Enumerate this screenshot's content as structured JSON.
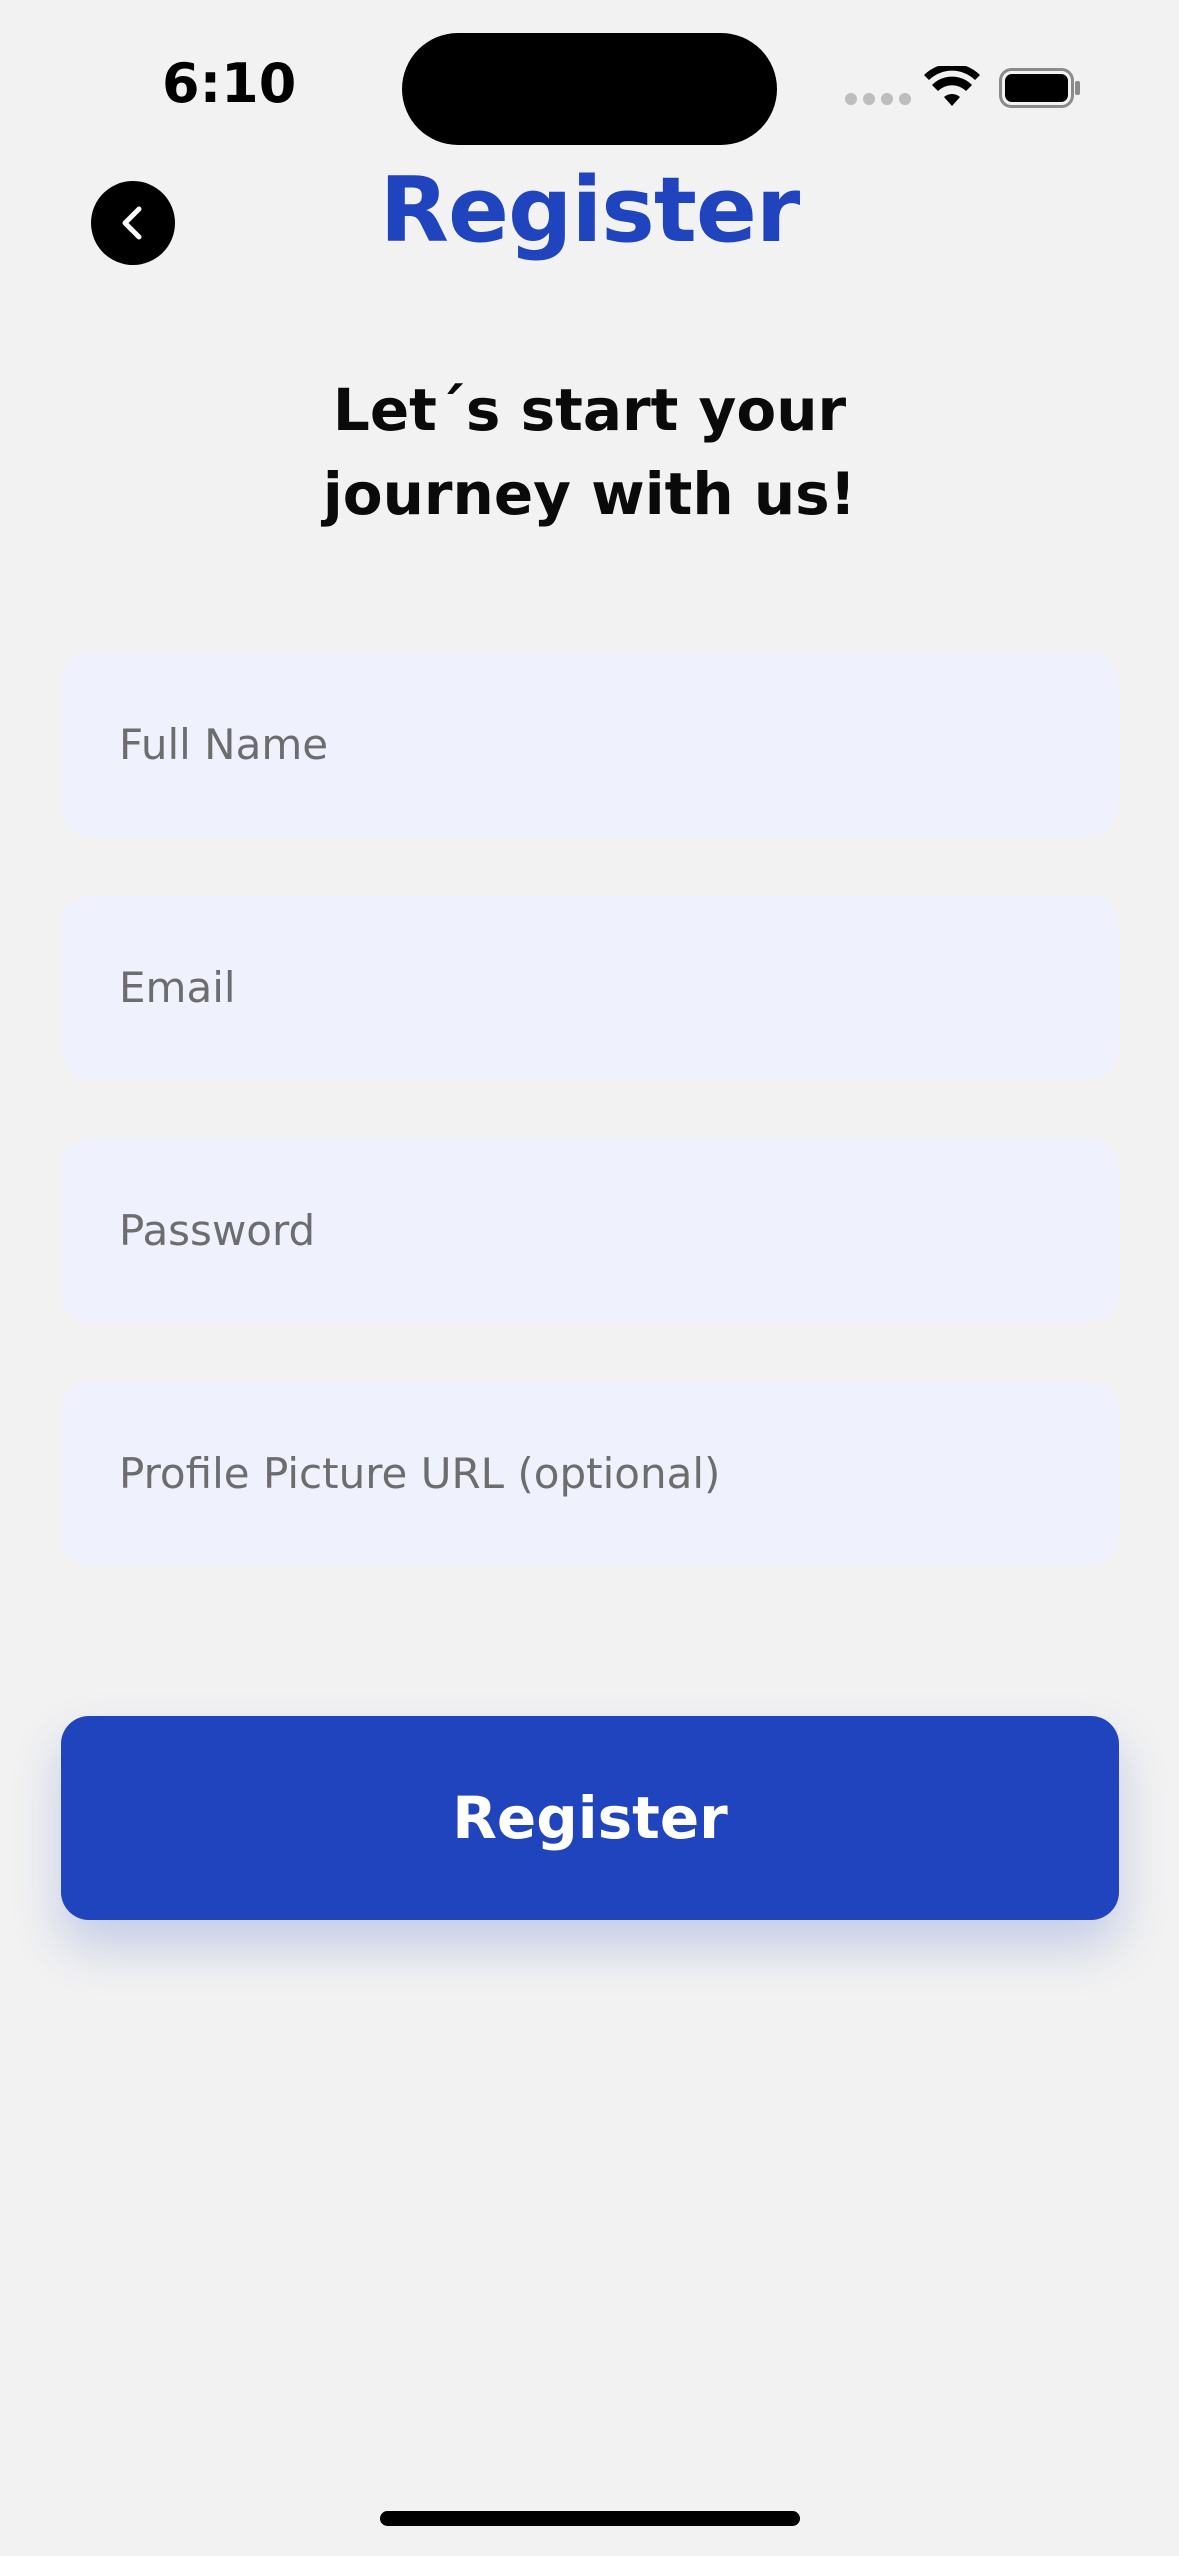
{
  "status_bar": {
    "time": "6:10"
  },
  "header": {
    "title": "Register",
    "back_icon": "chevron-left-icon"
  },
  "subtitle": "Let´s start your journey with us!",
  "form": {
    "full_name": {
      "placeholder": "Full Name",
      "value": ""
    },
    "email": {
      "placeholder": "Email",
      "value": ""
    },
    "password": {
      "placeholder": "Password",
      "value": ""
    },
    "profile_picture": {
      "placeholder": "Profile Picture URL (optional)",
      "value": ""
    }
  },
  "register_button": {
    "label": "Register"
  },
  "colors": {
    "accent": "#2043be",
    "background": "#f2f2f2",
    "field_background": "#eff2fd"
  }
}
